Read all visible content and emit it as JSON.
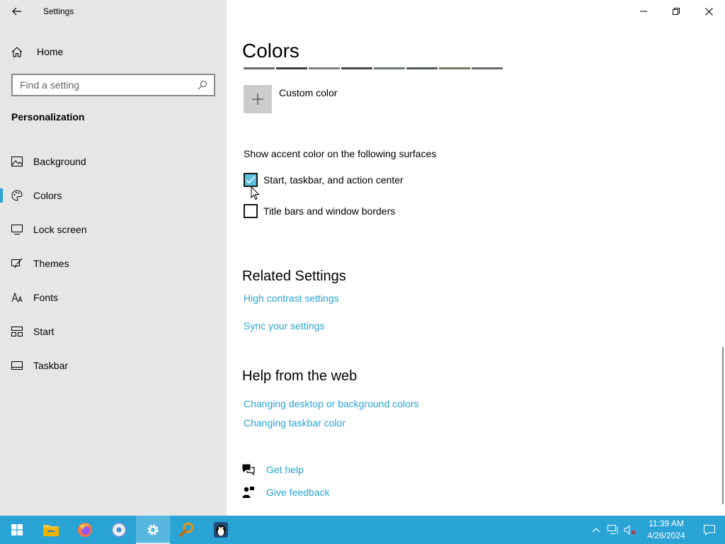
{
  "window": {
    "title": "Settings"
  },
  "sidebar": {
    "home_label": "Home",
    "search_placeholder": "Find a setting",
    "section_title": "Personalization",
    "items": [
      {
        "label": "Background",
        "icon": "image-icon"
      },
      {
        "label": "Colors",
        "icon": "palette-icon",
        "active": true
      },
      {
        "label": "Lock screen",
        "icon": "lock-screen-icon"
      },
      {
        "label": "Themes",
        "icon": "brush-icon"
      },
      {
        "label": "Fonts",
        "icon": "font-icon"
      },
      {
        "label": "Start",
        "icon": "start-layout-icon"
      },
      {
        "label": "Taskbar",
        "icon": "taskbar-icon"
      }
    ]
  },
  "main": {
    "title": "Colors",
    "swatches": [
      "#6b6b6b",
      "#3d3d3d",
      "#808080",
      "#4a4a4a",
      "#6e7a74",
      "#505a52",
      "#77745e",
      "#6b6b6b"
    ],
    "custom_color_label": "Custom color",
    "accent_heading": "Show accent color on the following surfaces",
    "checkboxes": [
      {
        "label": "Start, taskbar, and action center",
        "checked": true
      },
      {
        "label": "Title bars and window borders",
        "checked": false
      }
    ],
    "related_title": "Related Settings",
    "related_links": [
      "High contrast settings",
      "Sync your settings"
    ],
    "help_title": "Help from the web",
    "help_links": [
      "Changing desktop or background colors",
      "Changing taskbar color"
    ],
    "get_help": "Get help",
    "give_feedback": "Give feedback"
  },
  "taskbar": {
    "apps": [
      "start-icon",
      "file-explorer-icon",
      "firefox-icon",
      "chrome-icon",
      "settings-icon",
      "search-magnifier-icon",
      "penguin-icon"
    ],
    "active_app": "settings-icon",
    "time": "11:39 AM",
    "date": "4/26/2024"
  },
  "colors": {
    "accent": "#2aa3d5",
    "sidebar_bg": "#e6e6e6",
    "checkbox_fill": "#5bc0de"
  }
}
